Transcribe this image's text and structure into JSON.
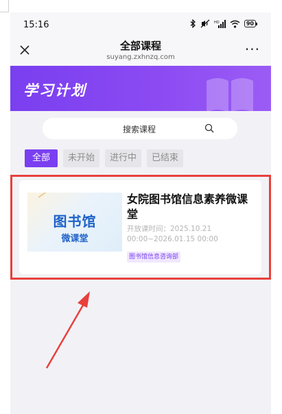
{
  "status_bar": {
    "time": "15:16",
    "icons": [
      "bluetooth-icon",
      "mute-icon",
      "signal-icon",
      "wifi-icon",
      "battery-icon"
    ],
    "battery": "90"
  },
  "nav": {
    "title": "全部课程",
    "url": "suyang.zxhnzq.com",
    "more": "···"
  },
  "banner": {
    "title": "学习计划"
  },
  "search": {
    "placeholder": "搜索课程"
  },
  "tabs": [
    {
      "label": "全部",
      "active": true
    },
    {
      "label": "未开始",
      "active": false
    },
    {
      "label": "进行中",
      "active": false
    },
    {
      "label": "已结束",
      "active": false
    }
  ],
  "course": {
    "thumb_title": "图书馆",
    "thumb_subtitle": "微课堂",
    "title": "女院图书馆信息素养微课堂",
    "time": "开放课时间：2025.10.21 00:00~2026.01.15 00:00",
    "tag": "图书馆信息咨询部"
  },
  "colors": {
    "accent": "#7a3ff0",
    "annotation": "#e8403c",
    "thumb_text": "#1f63c9"
  }
}
